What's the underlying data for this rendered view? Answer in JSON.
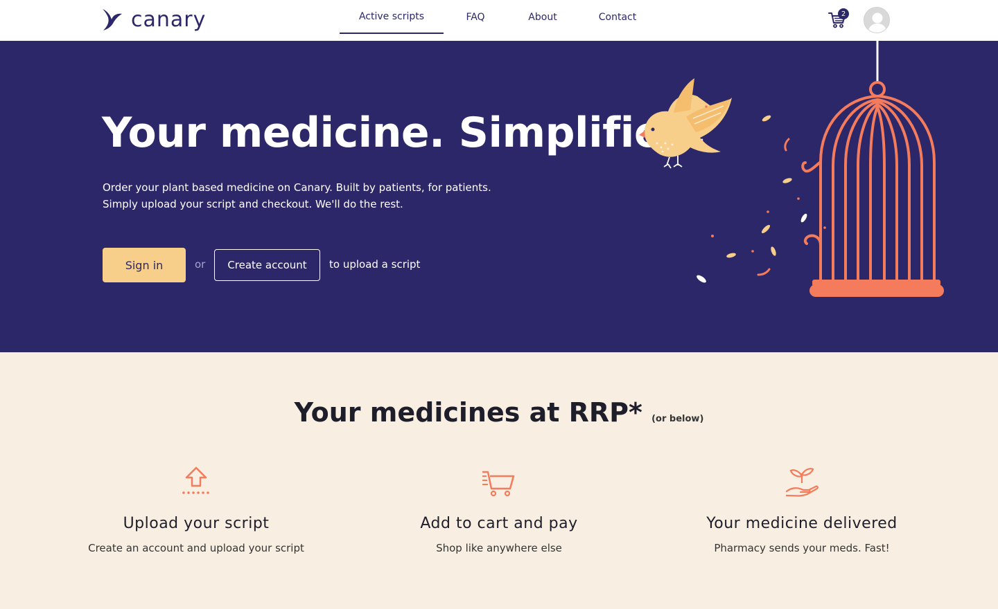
{
  "header": {
    "logo_text": "canary",
    "nav": [
      {
        "label": "Active scripts",
        "active": true
      },
      {
        "label": "FAQ",
        "active": false
      },
      {
        "label": "About",
        "active": false
      },
      {
        "label": "Contact",
        "active": false
      }
    ],
    "cart_count": "2",
    "icons": {
      "cart": "cart-icon",
      "avatar": "user-avatar-icon"
    }
  },
  "hero": {
    "title": "Your medicine. Simplified.",
    "subtitle_line1": "Order your plant based medicine on Canary. Built by patients, for patients.",
    "subtitle_line2": "Simply upload your script and checkout. We'll do the rest.",
    "signin_label": "Sign in",
    "or_text": "or",
    "create_account_label": "Create account",
    "upload_hint": "to upload a script"
  },
  "rrp": {
    "title": "Your medicines at RRP*",
    "note": "(or below)"
  },
  "features": [
    {
      "icon": "upload-icon",
      "title": "Upload your script",
      "description": "Create an account and upload your script"
    },
    {
      "icon": "cart-icon",
      "title": "Add to cart and pay",
      "description": "Shop like anywhere else"
    },
    {
      "icon": "plant-hand-icon",
      "title": "Your medicine delivered",
      "description": "Pharmacy sends your meds. Fast!"
    }
  ],
  "colors": {
    "brand_navy": "#2b2769",
    "accent_yellow": "#f8cf8a",
    "accent_coral": "#f47b5b",
    "cream_bg": "#f8efe2"
  }
}
